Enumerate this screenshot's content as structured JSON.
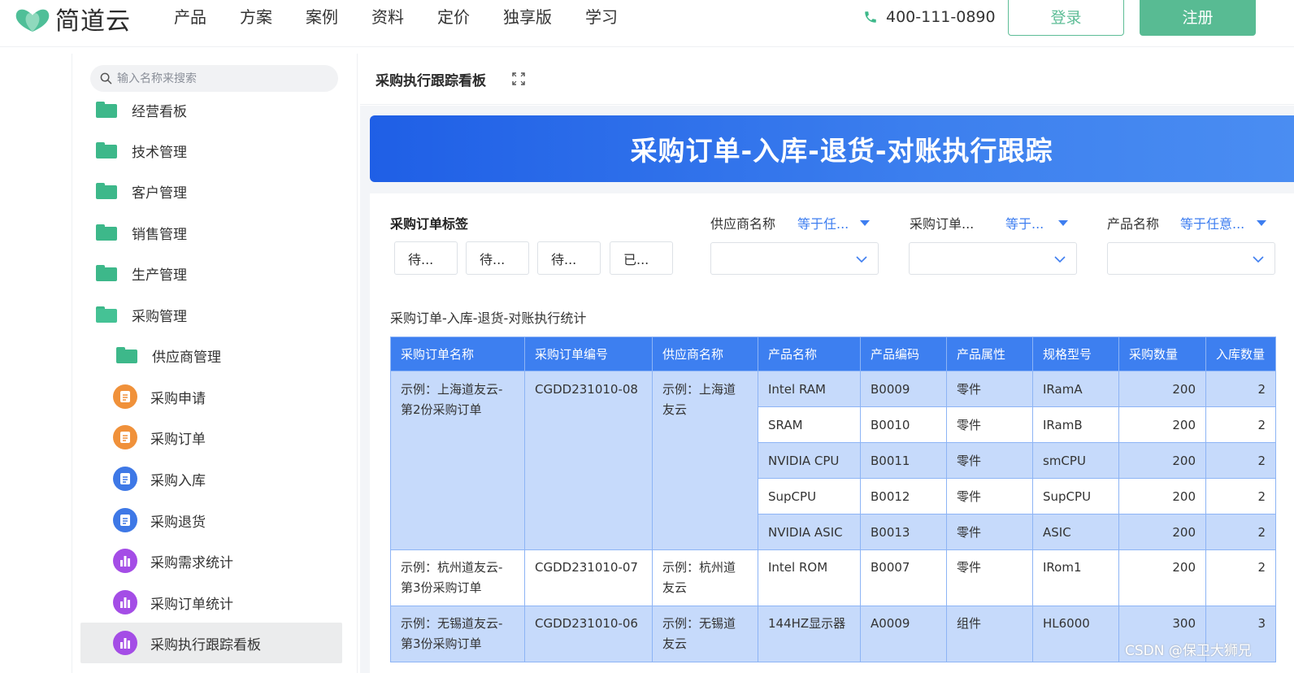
{
  "app": {
    "logo_text": "简道云",
    "nav": [
      "产品",
      "方案",
      "案例",
      "资料",
      "定价",
      "独享版",
      "学习"
    ],
    "phone": "400-111-0890",
    "login_label": "登录",
    "register_label": "注册",
    "brand_color": "#58bb93"
  },
  "sidebar": {
    "search_placeholder": "输入名称来搜索",
    "items": [
      {
        "label": "经营看板",
        "icon": "folder-icon"
      },
      {
        "label": "技术管理",
        "icon": "folder-icon"
      },
      {
        "label": "客户管理",
        "icon": "folder-icon"
      },
      {
        "label": "销售管理",
        "icon": "folder-icon"
      },
      {
        "label": "生产管理",
        "icon": "folder-icon"
      },
      {
        "label": "采购管理",
        "icon": "folder-open-icon"
      },
      {
        "label": "供应商管理",
        "icon": "folder-icon"
      },
      {
        "label": "采购申请",
        "icon": "form-icon"
      },
      {
        "label": "采购订单",
        "icon": "form-icon"
      },
      {
        "label": "采购入库",
        "icon": "form-icon"
      },
      {
        "label": "采购退货",
        "icon": "form-icon"
      },
      {
        "label": "采购需求统计",
        "icon": "chart-icon"
      },
      {
        "label": "采购订单统计",
        "icon": "chart-icon"
      },
      {
        "label": "采购执行跟踪看板",
        "icon": "chart-icon",
        "active": true
      }
    ]
  },
  "main": {
    "title": "采购执行跟踪看板",
    "banner_title": "采购订单-入库-退货-对账执行跟踪",
    "filters": {
      "tag_label": "采购订单标签",
      "tags": [
        "待...",
        "待...",
        "待...",
        "已..."
      ],
      "supplier_label": "供应商名称",
      "supplier_op": "等于任...",
      "order_label": "采购订单...",
      "order_op": "等于...",
      "product_label": "产品名称",
      "product_op": "等于任意..."
    },
    "table_caption": "采购订单-入库-退货-对账执行统计",
    "columns": [
      "采购订单名称",
      "采购订单编号",
      "供应商名称",
      "产品名称",
      "产品编码",
      "产品属性",
      "规格型号",
      "采购数量",
      "入库数量"
    ],
    "groups": [
      {
        "order_name": "示例：上海道友云-\n第2份采购订单",
        "order_no": "CGDD231010-08",
        "supplier": "示例：上海道\n友云",
        "products": [
          {
            "name": "Intel RAM",
            "code": "B0009",
            "attr": "零件",
            "spec": "IRamA",
            "qty": "200",
            "in": "2"
          },
          {
            "name": "SRAM",
            "code": "B0010",
            "attr": "零件",
            "spec": "IRamB",
            "qty": "200",
            "in": "2"
          },
          {
            "name": "NVIDIA CPU",
            "code": "B0011",
            "attr": "零件",
            "spec": "smCPU",
            "qty": "200",
            "in": "2"
          },
          {
            "name": "SupCPU",
            "code": "B0012",
            "attr": "零件",
            "spec": "SupCPU",
            "qty": "200",
            "in": "2"
          },
          {
            "name": "NVIDIA ASIC",
            "code": "B0013",
            "attr": "零件",
            "spec": "ASIC",
            "qty": "200",
            "in": "2"
          }
        ]
      },
      {
        "order_name": "示例：杭州道友云-\n第3份采购订单",
        "order_no": "CGDD231010-07",
        "supplier": "示例：杭州道\n友云",
        "products": [
          {
            "name": "Intel ROM",
            "code": "B0007",
            "attr": "零件",
            "spec": "IRom1",
            "qty": "200",
            "in": "2"
          }
        ]
      },
      {
        "order_name": "示例：无锡道友云-\n第3份采购订单",
        "order_no": "CGDD231010-06",
        "supplier": "示例：无锡道\n友云",
        "products": [
          {
            "name": "144HZ显示器",
            "code": "A0009",
            "attr": "组件",
            "spec": "HL6000",
            "qty": "300",
            "in": "3"
          }
        ]
      }
    ]
  },
  "watermark": "CSDN @保卫大狮兄"
}
